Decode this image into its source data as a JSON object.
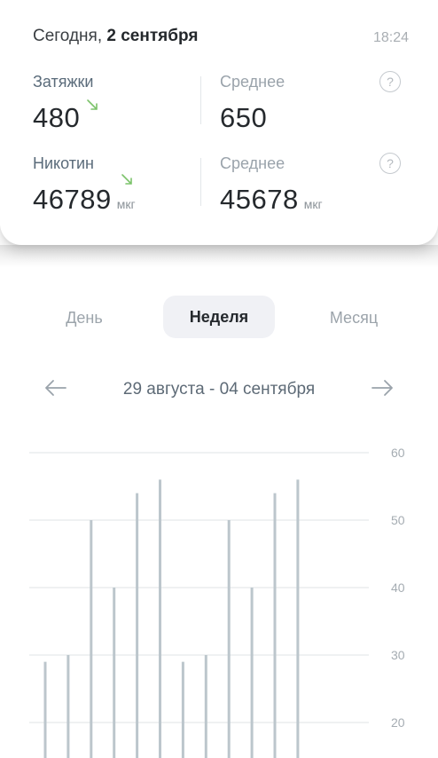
{
  "header": {
    "date_prefix": "Сегодня, ",
    "date_bold": "2 сентября",
    "time": "18:24"
  },
  "stats": {
    "puffs": {
      "label": "Затяжки",
      "value": "480",
      "avg_label": "Среднее",
      "avg_value": "650"
    },
    "nicotine": {
      "label": "Никотин",
      "value": "46789",
      "unit": "мкг",
      "avg_label": "Среднее",
      "avg_value": "45678",
      "avg_unit": "мкг"
    },
    "help_symbol": "?"
  },
  "tabs": [
    {
      "label": "День",
      "active": false
    },
    {
      "label": "Неделя",
      "active": true
    },
    {
      "label": "Месяц",
      "active": false
    }
  ],
  "range": {
    "label": "29 августа - 04 сентября"
  },
  "colors": {
    "trend_down": "#7cc36b",
    "bar": "#bcc6cc",
    "grid": "#dfe3e6",
    "axis_text": "#a5acb2"
  },
  "chart_data": {
    "type": "bar",
    "y_ticks": [
      60,
      50,
      40,
      30,
      20
    ],
    "ylim": [
      16,
      60
    ],
    "values": [
      29,
      30,
      50,
      40,
      54,
      56,
      29,
      30,
      50,
      40,
      54,
      56
    ],
    "grid": true,
    "xlabel": "",
    "ylabel": ""
  }
}
